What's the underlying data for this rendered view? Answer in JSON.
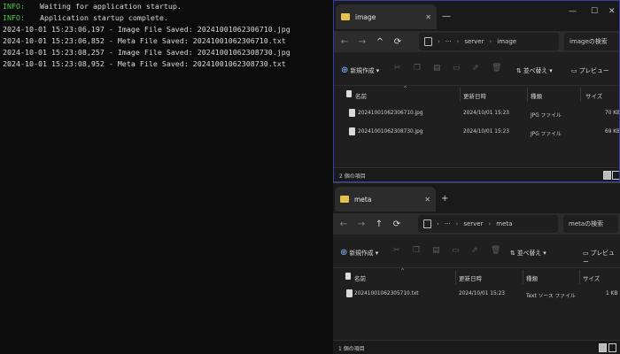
{
  "terminal": {
    "lines": [
      {
        "level": "INFO:",
        "text": "Waiting for application startup."
      },
      {
        "level": "INFO:",
        "text": "Application startup complete."
      },
      {
        "level": "",
        "text": "2024-10-01 15:23:06,197 - Image File Saved: 20241001062306710.jpg"
      },
      {
        "level": "",
        "text": "2024-10-01 15:23:06,852 - Meta File Saved: 20241001062306710.txt"
      },
      {
        "level": "",
        "text": "2024-10-01 15:23:08,257 - Image File Saved: 20241001062308730.jpg"
      },
      {
        "level": "",
        "text": "2024-10-01 15:23:08,952 - Meta File Saved: 20241001062308730.txt"
      }
    ]
  },
  "image_window": {
    "tab_title": "image",
    "path": {
      "root": "server",
      "folder": "image"
    },
    "search_placeholder": "imageの検索",
    "toolbar": {
      "new": "新規作成",
      "sort": "並べ替え",
      "preview": "プレビュー"
    },
    "columns": {
      "name": "名前",
      "modified": "更新日時",
      "type": "種類",
      "size": "サイズ"
    },
    "files": [
      {
        "name": "20241001062306710.jpg",
        "modified": "2024/10/01 15:23",
        "type": "JPG ファイル",
        "size": "70 KB"
      },
      {
        "name": "20241001062308730.jpg",
        "modified": "2024/10/01 15:23",
        "type": "JPG ファイル",
        "size": "69 KB"
      }
    ],
    "status": "2 個の項目"
  },
  "meta_window": {
    "tab_title": "meta",
    "path": {
      "root": "server",
      "folder": "meta"
    },
    "search_placeholder": "metaの検索",
    "toolbar": {
      "new": "新規作成",
      "sort": "並べ替え",
      "preview": "プレビュー"
    },
    "columns": {
      "name": "名前",
      "modified": "更新日時",
      "type": "種類",
      "size": "サイズ"
    },
    "files": [
      {
        "name": "20241001062305710.txt",
        "modified": "2024/10/01 15:23",
        "type": "Text ソース ファイル",
        "size": "1 KB"
      }
    ],
    "status": "1 個の項目"
  },
  "glyphs": {
    "close": "✕",
    "minimize": "—",
    "maximize": "☐",
    "plus": "+",
    "back": "←",
    "forward": "→",
    "up": "↑",
    "refresh": "⟳",
    "chevron": "›",
    "more": "···",
    "new_plus": "⊕",
    "cut": "✂",
    "sort": "⇅",
    "caret_up": "^"
  },
  "colors": {
    "terminal_bg": "#0c0c0c",
    "info_green": "#45c44a",
    "explorer_bg": "#1f1f1f",
    "folder_yellow": "#e8c04a",
    "active_border": "#3a3aa8"
  }
}
